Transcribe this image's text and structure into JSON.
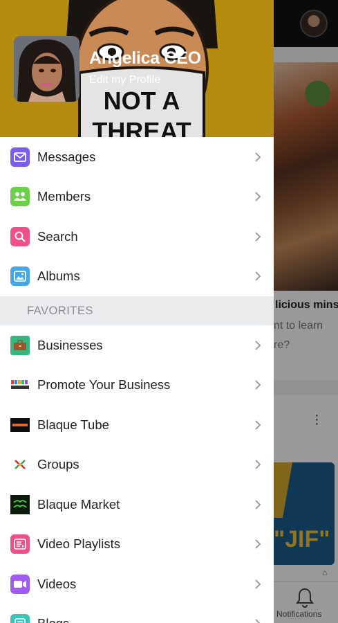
{
  "profile": {
    "name": "Angelica CEO",
    "edit_label": "Edit my Profile",
    "header_art_text_line1": "NOT A",
    "header_art_text_line2": "THREAT"
  },
  "menu": [
    {
      "label": "Messages",
      "icon": "envelope-icon",
      "color": "#7b5cf0"
    },
    {
      "label": "Members",
      "icon": "people-icon",
      "color": "#6ccf4a"
    },
    {
      "label": "Search",
      "icon": "search-icon",
      "color": "#f0508a"
    },
    {
      "label": "Albums",
      "icon": "image-icon",
      "color": "#41a6ea"
    }
  ],
  "favorites_heading": "FAVORITES",
  "favorites": [
    {
      "label": "Businesses",
      "icon": "briefcase-icon"
    },
    {
      "label": "Promote Your Business",
      "icon": "promote-logo-icon"
    },
    {
      "label": "Blaque Tube",
      "icon": "blaque-tube-logo-icon"
    },
    {
      "label": "Groups",
      "icon": "groups-logo-icon"
    },
    {
      "label": "Blaque Market",
      "icon": "blaque-market-logo-icon"
    },
    {
      "label": "Video Playlists",
      "icon": "playlist-icon",
      "color": "#f0508a"
    },
    {
      "label": "Videos",
      "icon": "video-camera-icon",
      "color": "#a05cf0"
    },
    {
      "label": "Blogs",
      "icon": "blog-icon",
      "color": "#35c6b8"
    }
  ],
  "background": {
    "card_title": "licious mins",
    "card_sub1": "nt to learn",
    "card_sub2": "re?",
    "promo_text": "\"JIF\"",
    "notifications_label": "Notifications"
  },
  "colors": {
    "header_bg": "#b48c10",
    "section_bg": "#e9ebed",
    "scrim": "rgba(0,0,0,0.40)"
  }
}
